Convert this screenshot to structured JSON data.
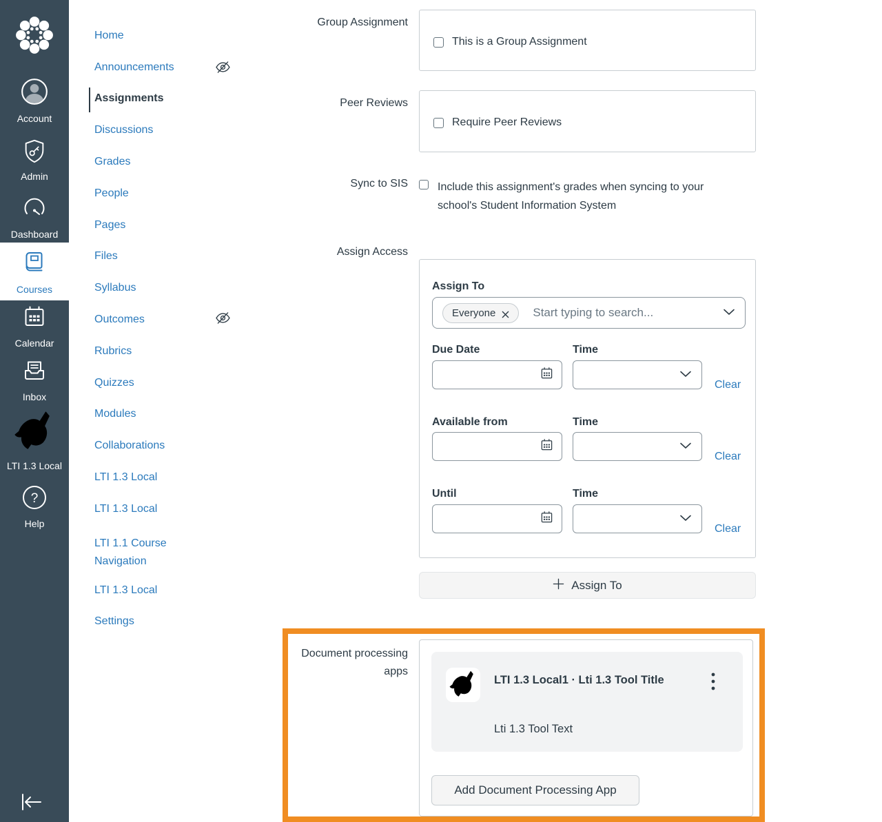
{
  "colors": {
    "nav_bg": "#394B58",
    "link_blue": "#2B7ABC",
    "text_dark": "#2D3B45",
    "border_gray": "#C7CDD1",
    "highlight_orange": "#F08D22",
    "panel_gray": "#F2F3F4",
    "button_gray": "#F5F5F5"
  },
  "global_nav": {
    "items": [
      {
        "label": "Account"
      },
      {
        "label": "Admin"
      },
      {
        "label": "Dashboard"
      },
      {
        "label": "Courses",
        "active": true
      },
      {
        "label": "Calendar"
      },
      {
        "label": "Inbox"
      },
      {
        "label": "LTI 1.3 Local"
      },
      {
        "label": "Help"
      }
    ]
  },
  "course_nav": {
    "items": [
      {
        "label": "Home"
      },
      {
        "label": "Announcements",
        "hidden": true
      },
      {
        "label": "Assignments",
        "active": true
      },
      {
        "label": "Discussions"
      },
      {
        "label": "Grades"
      },
      {
        "label": "People"
      },
      {
        "label": "Pages"
      },
      {
        "label": "Files"
      },
      {
        "label": "Syllabus"
      },
      {
        "label": "Outcomes",
        "hidden": true
      },
      {
        "label": "Rubrics"
      },
      {
        "label": "Quizzes"
      },
      {
        "label": "Modules"
      },
      {
        "label": "Collaborations"
      },
      {
        "label": "LTI 1.3 Local"
      },
      {
        "label": "LTI 1.3 Local"
      },
      {
        "label": "LTI 1.1 Course Navigation"
      },
      {
        "label": "LTI 1.3 Local"
      },
      {
        "label": "Settings"
      }
    ]
  },
  "form": {
    "group_assignment": {
      "label": "Group Assignment",
      "checkbox_label": "This is a Group Assignment"
    },
    "peer_reviews": {
      "label": "Peer Reviews",
      "checkbox_label": "Require Peer Reviews"
    },
    "sync_to_sis": {
      "label": "Sync to SIS",
      "checkbox_label": "Include this assignment's grades when syncing to your school's Student Information System"
    },
    "assign_access": {
      "label": "Assign Access",
      "assign_to_heading": "Assign To",
      "everyone_tag": "Everyone",
      "search_placeholder": "Start typing to search...",
      "rows": [
        {
          "date_label": "Due Date",
          "time_label": "Time",
          "clear": "Clear"
        },
        {
          "date_label": "Available from",
          "time_label": "Time",
          "clear": "Clear"
        },
        {
          "date_label": "Until",
          "time_label": "Time",
          "clear": "Clear"
        }
      ],
      "add_assign_to_button": "Assign To"
    },
    "document_processing": {
      "label": "Document processing apps",
      "app_title": "LTI 1.3 Local1 · Lti 1.3 Tool Title",
      "app_text": "Lti 1.3 Tool Text",
      "add_button": "Add Document Processing App"
    }
  }
}
